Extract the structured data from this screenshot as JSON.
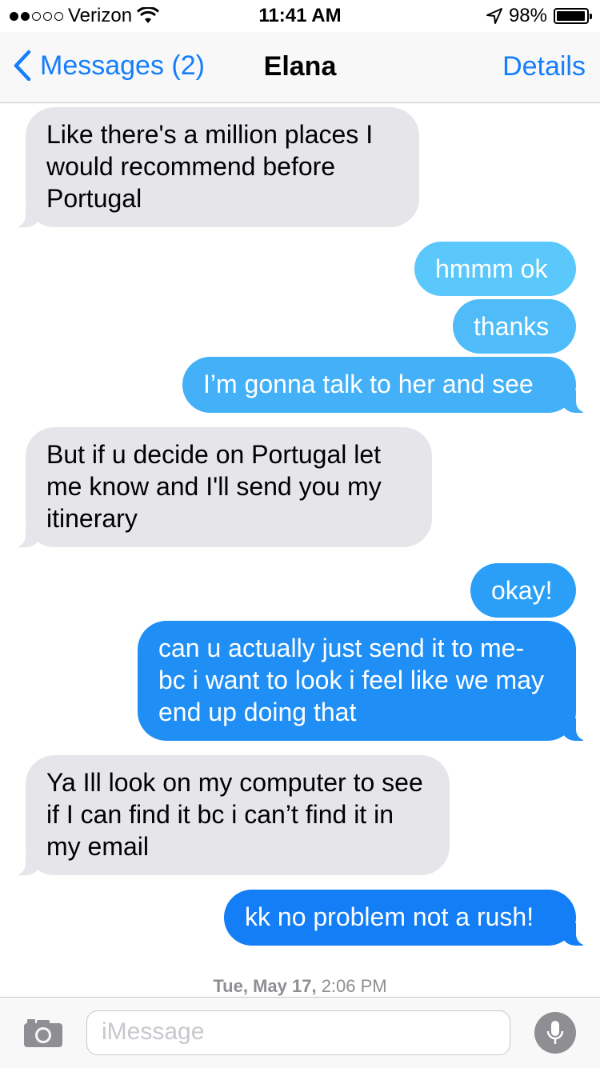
{
  "status_bar": {
    "carrier": "Verizon",
    "time": "11:41 AM",
    "battery_text": "98%",
    "battery_level": 0.98
  },
  "nav": {
    "back_label": "Messages (2)",
    "title": "Elana",
    "details_label": "Details"
  },
  "messages": [
    {
      "direction": "incoming",
      "text": "Like there's a million places I would recommend before Portugal"
    },
    {
      "direction": "outgoing",
      "text": "hmmm ok",
      "color": "#5ac8fa"
    },
    {
      "direction": "outgoing",
      "text": "thanks",
      "color": "#4fbcf9"
    },
    {
      "direction": "outgoing",
      "text": "I’m gonna talk to her and see",
      "color": "#43b0f8"
    },
    {
      "direction": "incoming",
      "text": "But if u decide on Portugal let me know and I'll send you my itinerary"
    },
    {
      "direction": "outgoing",
      "text": "okay!",
      "color": "#2b9ff7"
    },
    {
      "direction": "outgoing",
      "text": "can u actually just send it to me- bc i want to look i feel like we may end up doing that",
      "color": "#1f8ff6"
    },
    {
      "direction": "incoming",
      "text": "Ya Ill look on my computer to see if I can find it bc i can’t find it in my email"
    },
    {
      "direction": "outgoing",
      "text": "kk no problem not a rush!",
      "color": "#137ef5"
    }
  ],
  "timestamp": {
    "day": "Tue, May 17,",
    "time": "2:06 PM"
  },
  "input": {
    "placeholder": "iMessage"
  },
  "colors": {
    "accent": "#157efb",
    "incoming_bubble": "#e5e5ea"
  }
}
